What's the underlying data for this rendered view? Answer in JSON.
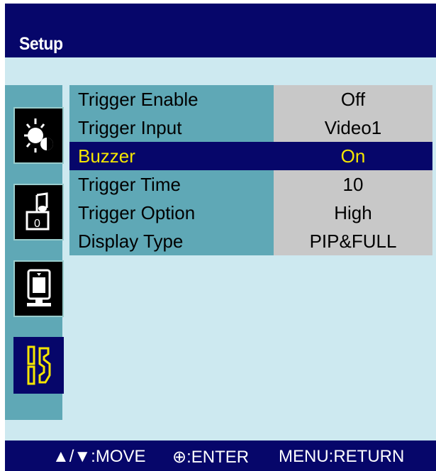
{
  "header": {
    "title": "Setup"
  },
  "sidebar": {
    "icons": [
      {
        "name": "picture-icon"
      },
      {
        "name": "sound-icon"
      },
      {
        "name": "pip-icon"
      },
      {
        "name": "setup-tools-icon",
        "active": true
      }
    ]
  },
  "menu": {
    "rows": [
      {
        "label": "Trigger Enable",
        "value": "Off"
      },
      {
        "label": "Trigger Input",
        "value": "Video1"
      },
      {
        "label": "Buzzer",
        "value": "On",
        "selected": true
      },
      {
        "label": "Trigger Time",
        "value": "10"
      },
      {
        "label": "Trigger Option",
        "value": "High"
      },
      {
        "label": "Display Type",
        "value": "PIP&FULL"
      }
    ]
  },
  "footer": {
    "move": "▲/▼:MOVE",
    "enter": "⊕:ENTER",
    "return": "MENU:RETURN"
  },
  "colors": {
    "header_bg": "#06066a",
    "body_bg": "#cde9f0",
    "label_bg": "#5fa8b6",
    "value_bg": "#c8c8c8",
    "selected_text": "#f5e600"
  }
}
